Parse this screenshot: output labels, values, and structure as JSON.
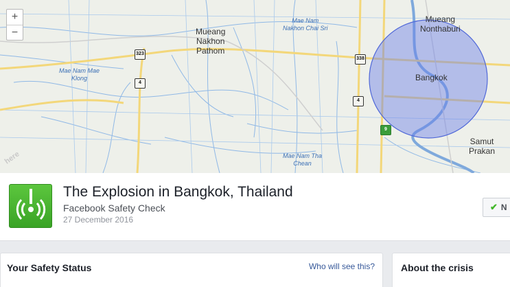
{
  "map": {
    "zoom_in_label": "+",
    "zoom_out_label": "−",
    "provider_logo": "here",
    "cities": {
      "mueang_nakhon_pathom": "Mueang\nNakhon\nPathom",
      "mueang_nonthaburi": "Mueang\nNonthaburi",
      "bangkok": "Bangkok",
      "samut_prakan": "Samut\nPrakan"
    },
    "water": {
      "mae_nam_mae_klong": "Mae Nam Mae\nKlong",
      "mae_nam_nakhon_chai_sri": "Mae Nam\nNakhon Chai Sri",
      "mae_nam_tha_chean": "Mae Nam Tha\nChean"
    },
    "road_shields": {
      "r323": "323",
      "r4a": "4",
      "r338": "338",
      "r4b": "4",
      "r9": "9"
    },
    "circle_color": "#6a7fe8"
  },
  "event": {
    "title": "The Explosion in Bangkok, Thailand",
    "source": "Facebook Safety Check",
    "date": "27 December 2016",
    "mark_safe_label": "N"
  },
  "panels": {
    "safety_status_title": "Your Safety Status",
    "who_will_see": "Who will see this?",
    "about_crisis_title": "About the crisis"
  },
  "colors": {
    "safety_green": "#42b72a",
    "link_blue": "#365899"
  }
}
